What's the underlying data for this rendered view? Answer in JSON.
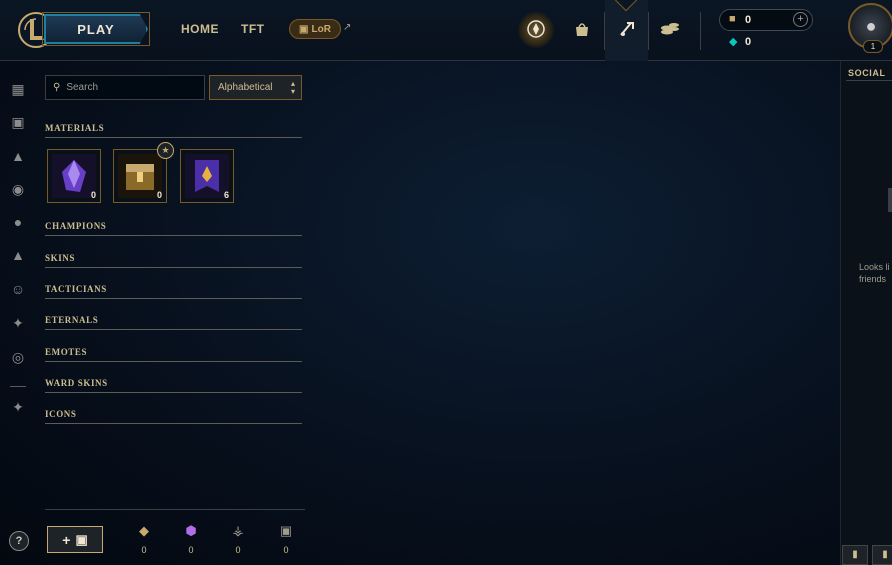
{
  "topbar": {
    "play_label": "PLAY",
    "nav": [
      "HOME",
      "TFT"
    ],
    "lor_label": "LoR",
    "lor_external_icon": "external-link-icon",
    "icons": [
      "clash-icon",
      "store-icon",
      "loot-icon",
      "currency-icon"
    ]
  },
  "currency": {
    "rp_value": "0",
    "be_value": "0"
  },
  "profile": {
    "level": "1"
  },
  "rail": {
    "icons": [
      "grid-icon",
      "chest-icon",
      "champion-icon",
      "mask-icon",
      "skin-icon",
      "tactician-icon",
      "emote-icon",
      "eternals-icon",
      "profile-icon",
      "ward-icon"
    ]
  },
  "search": {
    "placeholder": "Search",
    "sort_value": "Alphabetical"
  },
  "categories": {
    "materials": "MATERIALS",
    "champions": "CHAMPIONS",
    "skins": "SKINS",
    "tacticians": "TACTICIANS",
    "eternals": "ETERNALS",
    "emotes": "EMOTES",
    "ward_skins": "WARD SKINS",
    "icons": "ICONS"
  },
  "materials": [
    {
      "name": "gem-shard",
      "count": "0"
    },
    {
      "name": "hextech-chest",
      "count": "0"
    },
    {
      "name": "event-token",
      "count": "6"
    }
  ],
  "bottom": {
    "add_label": "+",
    "resources": [
      {
        "icon": "orange-essence-icon",
        "value": "0",
        "color": "#c8aa6e"
      },
      {
        "icon": "mythic-essence-icon",
        "value": "0",
        "color": "#b06de6"
      },
      {
        "icon": "key-icon",
        "value": "0",
        "color": "#a09b8c"
      },
      {
        "icon": "chest-icon",
        "value": "0",
        "color": "#a09b8c"
      }
    ]
  },
  "social": {
    "title": "SOCIAL",
    "message_line1": "Looks li",
    "message_line2": "friends"
  },
  "help_label": "?"
}
